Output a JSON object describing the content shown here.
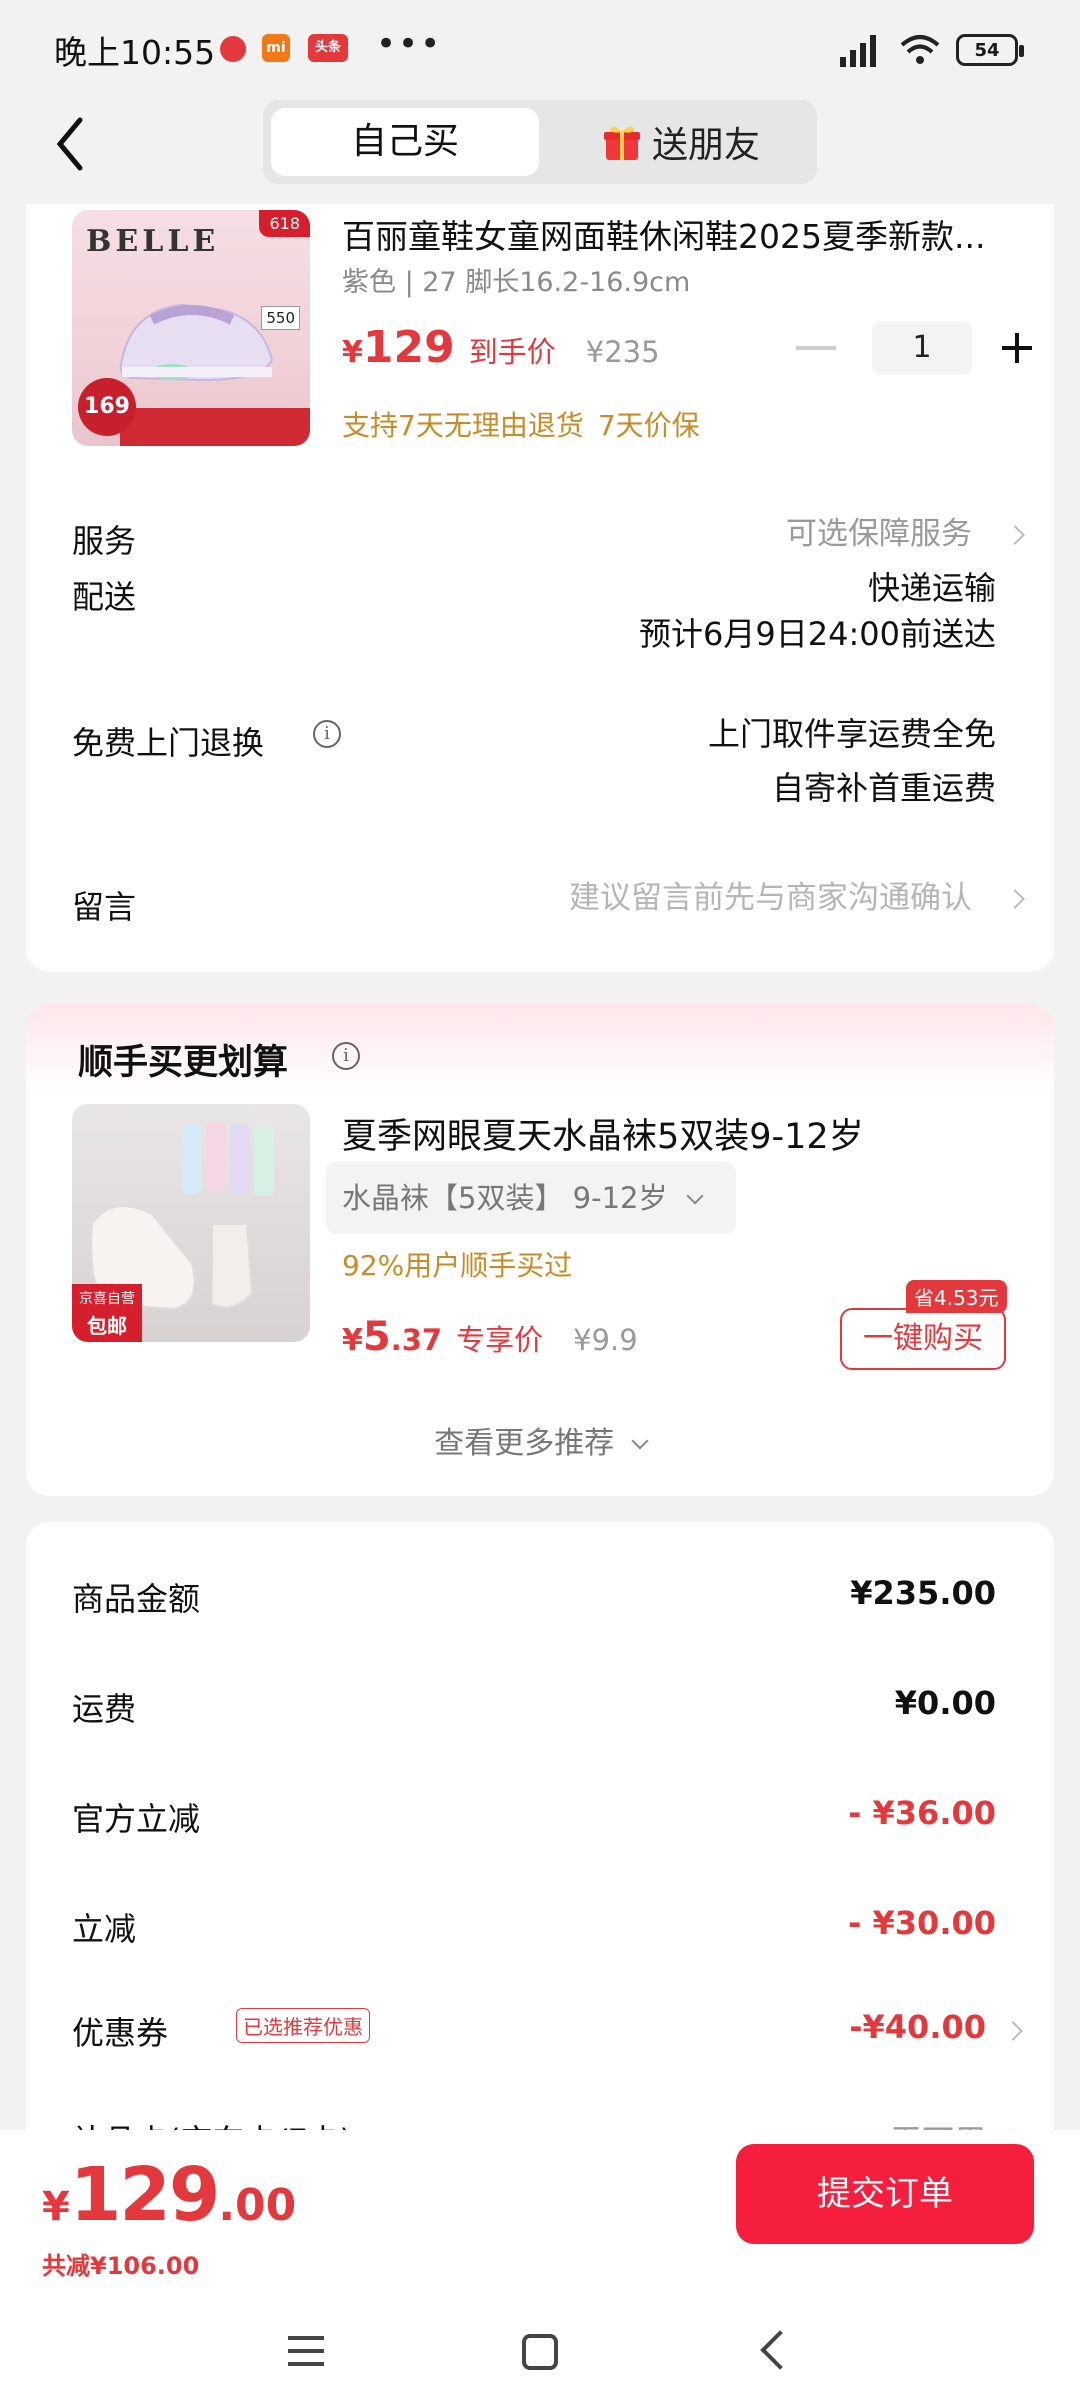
{
  "status_bar": {
    "time": "晚上10:55",
    "app_icons": [
      "mi-icon",
      "toutiao-icon"
    ],
    "app_badge_text": "头条",
    "battery": "54"
  },
  "nav": {
    "tab_self": "自己买",
    "tab_gift": "送朋友"
  },
  "product": {
    "brand": "BELLE",
    "promo_tag": "618",
    "image_price": "169",
    "image_sticker": "550",
    "title": "百丽童鞋女童网面鞋休闲鞋2025夏季新款...",
    "spec": "紫色 | 27 脚长16.2-16.9cm",
    "price_symbol": "¥",
    "price": "129",
    "price_label": "到手价",
    "original_price": "¥235",
    "quantity": "1",
    "service_tags": [
      "支持7天无理由退货",
      "7天价保"
    ]
  },
  "order_rows": {
    "service_label": "服务",
    "service_value": "可选保障服务",
    "delivery_label": "配送",
    "delivery_method": "快递运输",
    "delivery_eta": "预计6月9日24:00前送达",
    "return_label": "免费上门退换",
    "return_line1": "上门取件享运费全免",
    "return_line2": "自寄补首重运费",
    "message_label": "留言",
    "message_placeholder": "建议留言前先与商家沟通确认"
  },
  "addon": {
    "title": "顺手买更划算",
    "item_title": "夏季网眼夏天水晶袜5双装9-12岁",
    "item_variant": "水晶袜【5双装】  9-12岁",
    "item_badge_top": "京喜自营",
    "item_badge_bottom": "包邮",
    "bought_ratio": "92%用户顺手买过",
    "price_symbol": "¥",
    "price_int": "5",
    "price_dec": ".37",
    "price_label": "专享价",
    "original_price": "¥9.9",
    "save_tag": "省4.53元",
    "buy_button": "一键购买",
    "more": "查看更多推荐"
  },
  "fees": {
    "goods_label": "商品金额",
    "goods_value": "¥235.00",
    "shipping_label": "运费",
    "shipping_value": "¥0.00",
    "official_label": "官方立减",
    "official_value": "- ¥36.00",
    "instant_label": "立减",
    "instant_value": "- ¥30.00",
    "coupon_label": "优惠券",
    "coupon_tag": "已选推荐优惠",
    "coupon_value": "-¥40.00",
    "partial_label": "补品卡(京东卡/E卡)",
    "partial_value": "无可用"
  },
  "bottom": {
    "price_symbol": "¥",
    "total_int": "129",
    "total_dec": ".00",
    "total_saved": "共减¥106.00",
    "submit": "提交订单"
  },
  "colors": {
    "accent_red": "#e4393c",
    "submit_red": "#f51f3d",
    "service_gold": "#c98b26",
    "background": "#f2f2f2"
  }
}
